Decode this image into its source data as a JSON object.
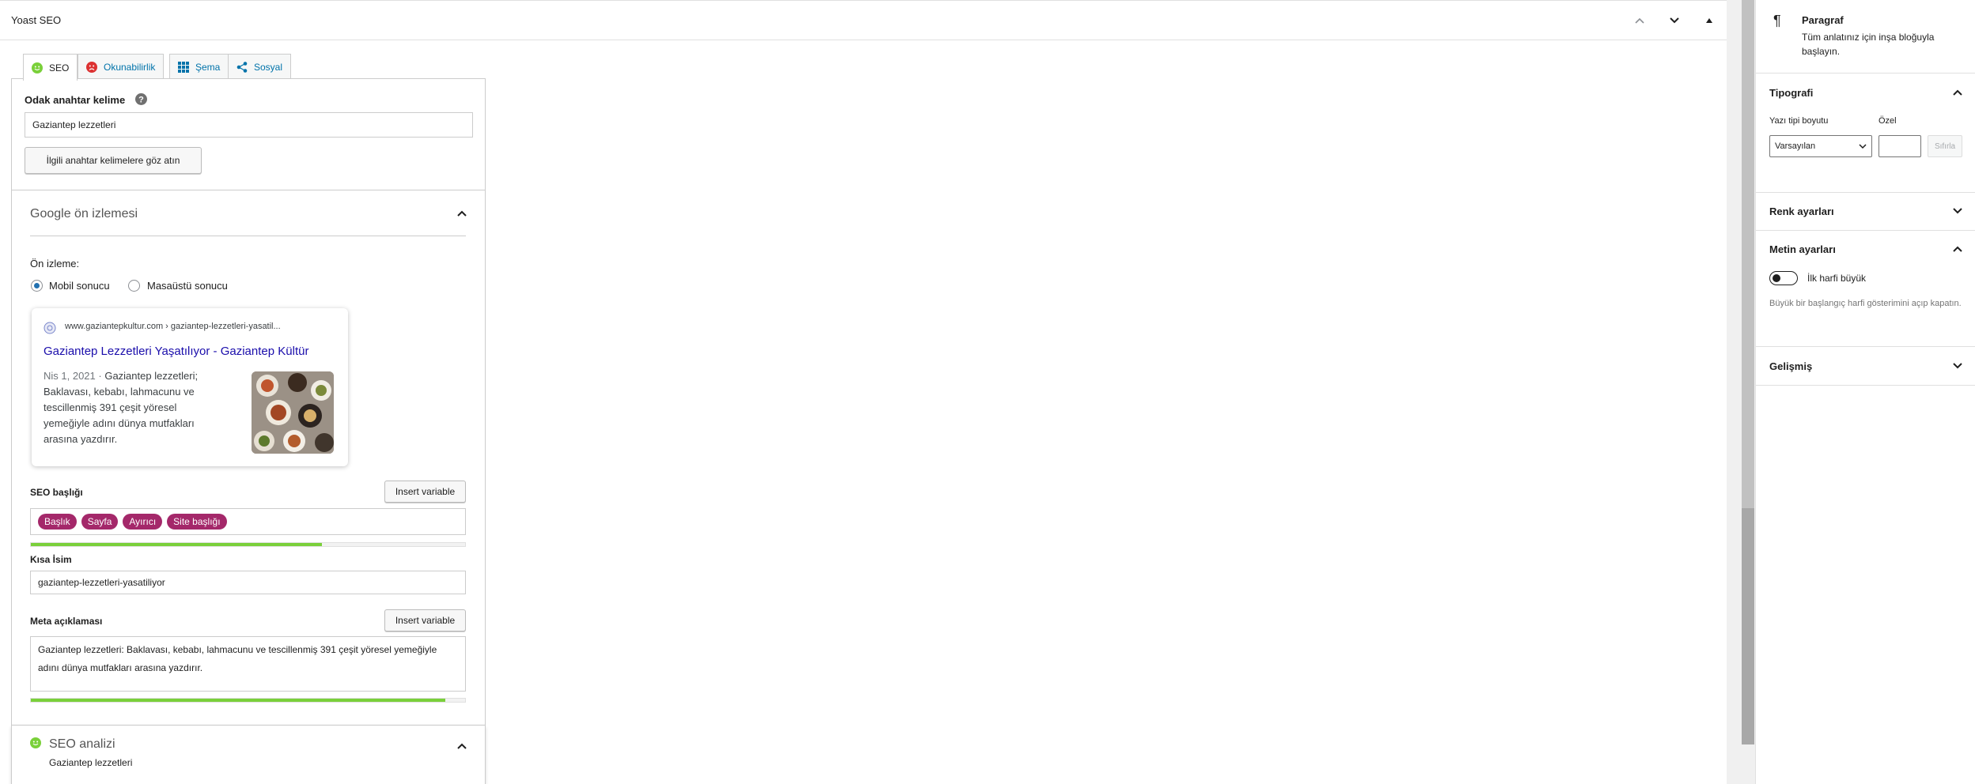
{
  "yoast": {
    "title": "Yoast SEO",
    "tabs": [
      {
        "label": "SEO"
      },
      {
        "label": "Okunabilirlik"
      },
      {
        "label": "Şema"
      },
      {
        "label": "Sosyal"
      }
    ],
    "focus_keyword": {
      "label": "Odak anahtar kelime",
      "value": "Gaziantep lezzetleri",
      "related_button": "İlgili anahtar kelimelere göz atın"
    },
    "google_preview": {
      "title": "Google ön izlemesi",
      "preview_label": "Ön izleme:",
      "options": [
        "Mobil sonucu",
        "Masaüstü sonucu"
      ],
      "selected": "Mobil sonucu",
      "card": {
        "url": "www.gaziantepkultur.com › gaziantep-lezzetleri-yasatil...",
        "title": "Gaziantep Lezzetleri Yaşatılıyor - Gaziantep Kültür",
        "date": "Nis 1, 2021 ·",
        "description": "Gaziantep lezzetleri; Baklavası, kebabı, lahmacunu ve tescillenmiş 391 çeşit yöresel yemeğiyle adını dünya mutfakları arasına yazdırır."
      }
    },
    "seo_title": {
      "label": "SEO başlığı",
      "insert_variable": "Insert variable",
      "pills": [
        "Başlık",
        "Sayfa",
        "Ayırıcı",
        "Site başlığı"
      ],
      "progress": 0.67
    },
    "slug": {
      "label": "Kısa İsim",
      "value": "gaziantep-lezzetleri-yasatiliyor"
    },
    "meta_description": {
      "label": "Meta açıklaması",
      "insert_variable": "Insert variable",
      "value": "Gaziantep lezzetleri: Baklavası, kebabı, lahmacunu ve tescillenmiş 391 çeşit yöresel yemeğiyle adını dünya mutfakları arasına yazdırır.",
      "progress": 0.955
    },
    "seo_analysis": {
      "title": "SEO analizi",
      "subtitle": "Gaziantep lezzetleri"
    }
  },
  "sidebar": {
    "block": {
      "name": "Paragraf",
      "description": "Tüm anlatınız için inşa bloğuyla başlayın."
    },
    "typography": {
      "title": "Tipografi",
      "font_size_label": "Yazı tipi boyutu",
      "custom_label": "Özel",
      "select_value": "Varsayılan",
      "reset_button": "Sıfırla"
    },
    "color": {
      "title": "Renk ayarları"
    },
    "text_settings": {
      "title": "Metin ayarları",
      "toggle_label": "İlk harfi büyük",
      "help": "Büyük bir başlangıç harfi gösterimini açıp kapatın."
    },
    "advanced": {
      "title": "Gelişmiş"
    }
  },
  "colors": {
    "link": "#0073aa",
    "pill": "#a4286a",
    "progress_good": "#7ad03a",
    "google_title": "#1a0dab",
    "smiley_good": "#7ad03a",
    "smiley_bad": "#dc3232"
  }
}
